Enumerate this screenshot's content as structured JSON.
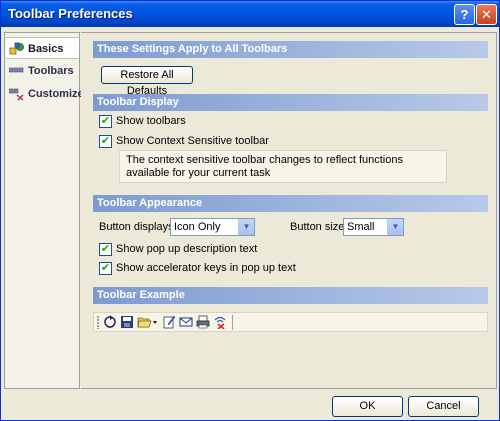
{
  "window": {
    "title": "Toolbar Preferences",
    "help_glyph": "?",
    "close_glyph": "✕"
  },
  "sidebar": {
    "items": [
      {
        "label": "Basics",
        "icon": "basics-icon",
        "active": true
      },
      {
        "label": "Toolbars",
        "icon": "toolbars-icon",
        "active": false
      },
      {
        "label": "Customize",
        "icon": "customize-icon",
        "active": false
      }
    ]
  },
  "sections": {
    "all_toolbars": {
      "header": "These Settings Apply to All Toolbars",
      "restore_button": "Restore All Defaults"
    },
    "display": {
      "header": "Toolbar Display",
      "show_toolbars": {
        "label": "Show toolbars",
        "checked": true
      },
      "show_context": {
        "label": "Show Context Sensitive toolbar",
        "checked": true
      },
      "info": "The context sensitive toolbar changes to reflect functions available for your current task"
    },
    "appearance": {
      "header": "Toolbar Appearance",
      "button_displays_label": "Button displays",
      "button_displays_value": "Icon Only",
      "button_size_label": "Button size",
      "button_size_value": "Small",
      "show_popup": {
        "label": "Show pop up description text",
        "checked": true
      },
      "show_accel": {
        "label": "Show accelerator keys in pop up text",
        "checked": true
      }
    },
    "example": {
      "header": "Toolbar Example",
      "tools": [
        "refresh-icon",
        "save-icon",
        "open-folder-icon",
        "edit-document-icon",
        "mail-icon",
        "print-icon",
        "disconnect-icon"
      ]
    }
  },
  "footer": {
    "ok_label": "OK",
    "cancel_label": "Cancel"
  }
}
